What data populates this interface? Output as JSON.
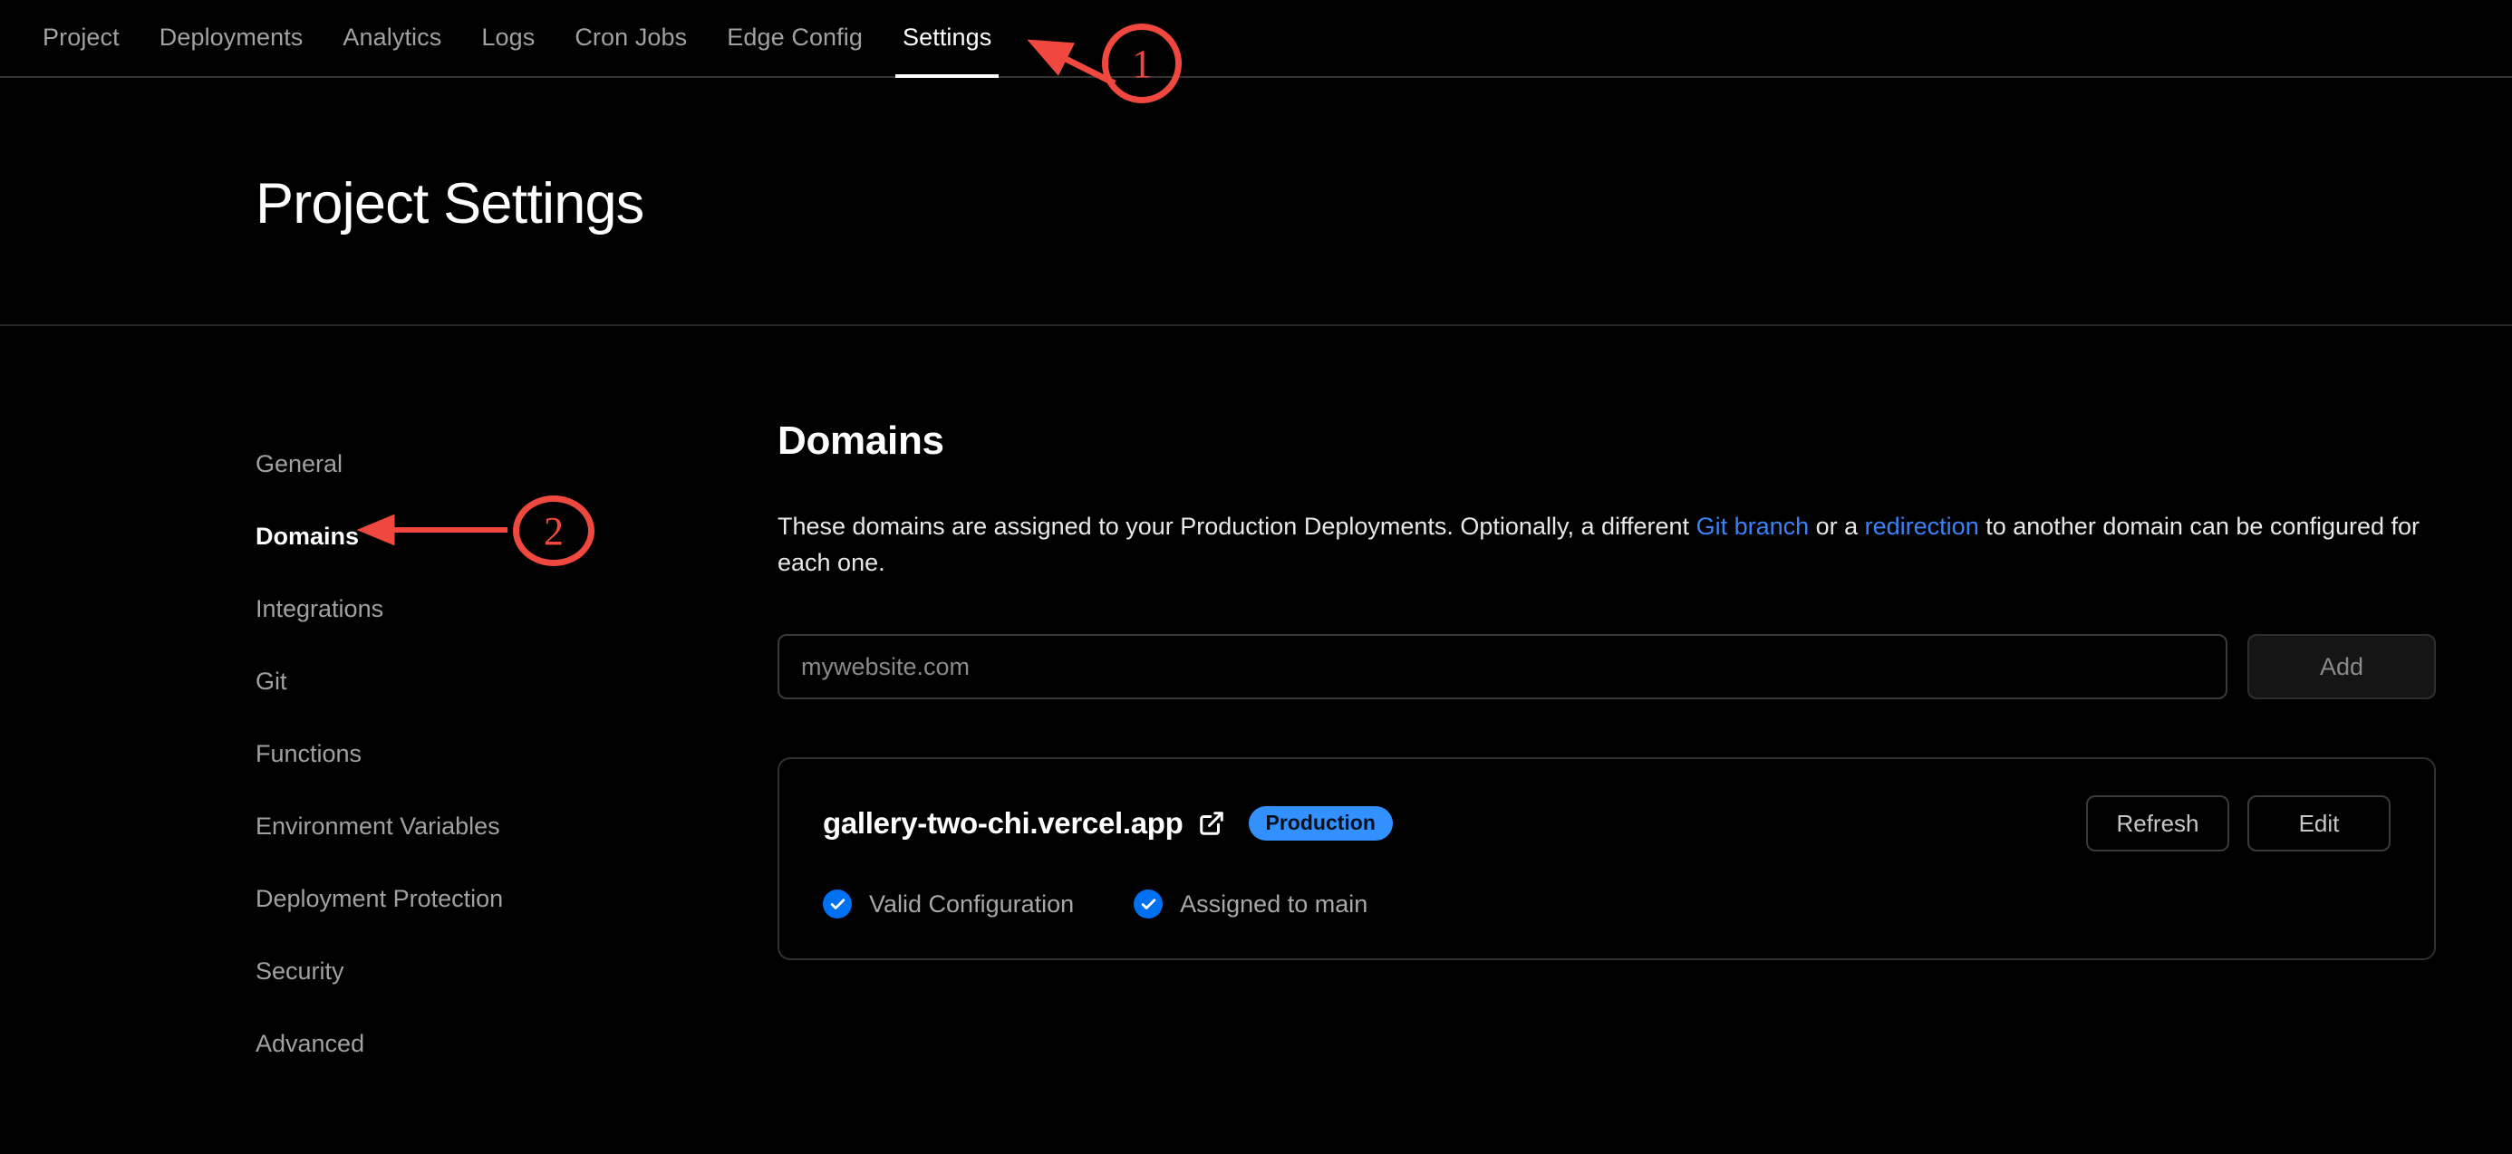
{
  "nav": {
    "tabs": [
      {
        "label": "Project",
        "active": false
      },
      {
        "label": "Deployments",
        "active": false
      },
      {
        "label": "Analytics",
        "active": false
      },
      {
        "label": "Logs",
        "active": false
      },
      {
        "label": "Cron Jobs",
        "active": false
      },
      {
        "label": "Edge Config",
        "active": false
      },
      {
        "label": "Settings",
        "active": true
      }
    ]
  },
  "header": {
    "title": "Project Settings"
  },
  "sidebar": {
    "items": [
      {
        "label": "General",
        "active": false
      },
      {
        "label": "Domains",
        "active": true
      },
      {
        "label": "Integrations",
        "active": false
      },
      {
        "label": "Git",
        "active": false
      },
      {
        "label": "Functions",
        "active": false
      },
      {
        "label": "Environment Variables",
        "active": false
      },
      {
        "label": "Deployment Protection",
        "active": false
      },
      {
        "label": "Security",
        "active": false
      },
      {
        "label": "Advanced",
        "active": false
      }
    ]
  },
  "main": {
    "title": "Domains",
    "description": {
      "part1": "These domains are assigned to your Production Deployments. Optionally, a different ",
      "link1": "Git branch",
      "part2": " or a ",
      "link2": "redirection",
      "part3": " to another domain can be configured for each one."
    },
    "add_form": {
      "input_value": "",
      "input_placeholder": "mywebsite.com",
      "add_label": "Add"
    },
    "domain_card": {
      "domain": "gallery-two-chi.vercel.app",
      "external_link_icon": "external-link-icon",
      "badge": "Production",
      "refresh_label": "Refresh",
      "edit_label": "Edit",
      "statuses": [
        {
          "icon": "check-circle-icon",
          "label": "Valid Configuration"
        },
        {
          "icon": "check-circle-icon",
          "label": "Assigned to main"
        }
      ]
    }
  },
  "annotations": [
    {
      "number": "1",
      "target": "settings-tab"
    },
    {
      "number": "2",
      "target": "sidebar-item-domains"
    }
  ],
  "colors": {
    "background": "#000000",
    "accent_blue": "#0070f3",
    "badge_blue": "#3291ff",
    "link_blue": "#3b82f6",
    "annotation_red": "#f0483e",
    "text_primary": "#ffffff",
    "text_muted": "#a1a1a1"
  }
}
